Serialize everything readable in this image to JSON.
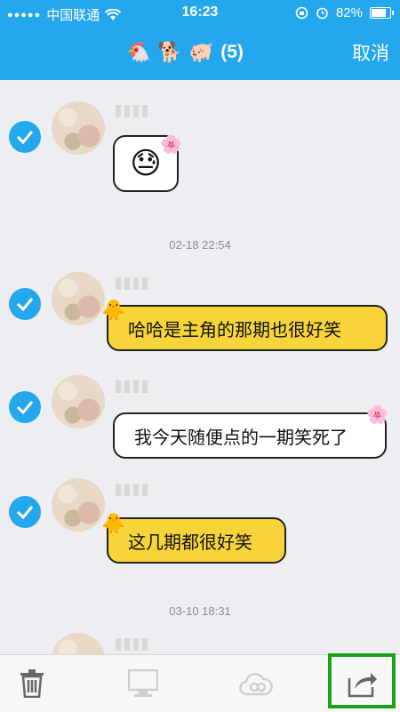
{
  "status_bar": {
    "signal_dots": "●●●●●",
    "carrier": "中国联通",
    "time": "16:23",
    "battery": "82%"
  },
  "header": {
    "emojis": [
      "🐔",
      "🐕",
      "🐖"
    ],
    "count": "(5)",
    "cancel_label": "取消"
  },
  "messages": [
    {
      "type": "sticker",
      "text": "😓",
      "selected": true
    },
    {
      "type": "timestamp",
      "text": "02-18 22:54"
    },
    {
      "type": "text",
      "text": "哈哈是主角的那期也很好笑",
      "bubble": "yellow",
      "selected": true
    },
    {
      "type": "text",
      "text": "我今天随便点的一期笑死了",
      "bubble": "white",
      "selected": true
    },
    {
      "type": "text",
      "text": "这几期都很好笑",
      "bubble": "yellow",
      "selected": true
    },
    {
      "type": "timestamp",
      "text": "03-10 18:31"
    }
  ],
  "toolbar": [
    "trash",
    "monitor",
    "cloud",
    "share"
  ],
  "colors": {
    "header": "#25a7ee",
    "check": "#25a7ee",
    "yellow_bubble": "#f7d53a",
    "highlight": "#1aa31a"
  }
}
